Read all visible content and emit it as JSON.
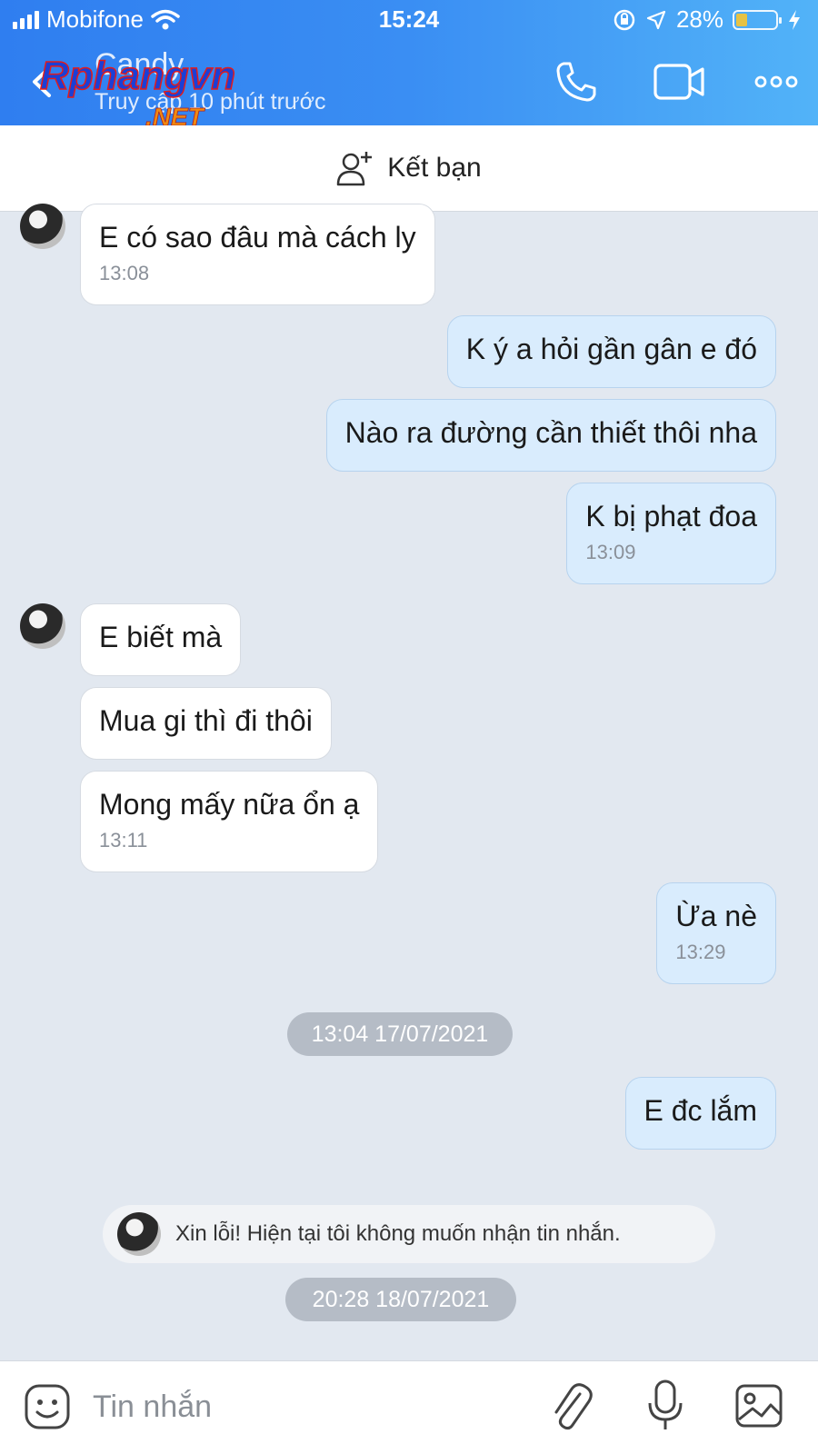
{
  "status_bar": {
    "carrier": "Mobifone",
    "time": "15:24",
    "battery_percent": "28%",
    "battery_level": 0.28
  },
  "header": {
    "contact_name": "Candy",
    "contact_status": "Truy cập 10 phút trước",
    "watermark_text": "Rphangvn",
    "watermark_suffix": ".NET"
  },
  "friend_bar": {
    "label": "Kết bạn"
  },
  "messages": [
    {
      "side": "incoming",
      "text": "E có sao đâu mà cách ly",
      "time": "13:08"
    },
    {
      "side": "outgoing",
      "text": "K ý a hỏi gần gân e đó",
      "time": ""
    },
    {
      "side": "outgoing",
      "text": "Nào ra đường cần thiết thôi nha",
      "time": ""
    },
    {
      "side": "outgoing",
      "text": "K bị phạt đoa",
      "time": "13:09"
    },
    {
      "side": "incoming",
      "text": "E biết mà",
      "time": ""
    },
    {
      "side": "incoming",
      "text": "Mua gi thì đi thôi",
      "time": ""
    },
    {
      "side": "incoming",
      "text": "Mong mấy nữa ổn ạ",
      "time": "13:11"
    },
    {
      "side": "outgoing",
      "text": "Ừa nè",
      "time": "13:29"
    },
    {
      "side": "outgoing",
      "text": "E đc lắm",
      "time": ""
    }
  ],
  "date_separators": [
    "13:04 17/07/2021",
    "20:28 18/07/2021"
  ],
  "system_message": "Xin lỗi! Hiện tại tôi không muốn nhận tin nhắn.",
  "input_bar": {
    "placeholder": "Tin nhắn"
  },
  "colors": {
    "header_start": "#2f7ef0",
    "header_end": "#52b3f8",
    "outgoing_bubble": "#d9ecfd",
    "incoming_bubble": "#ffffff",
    "chat_background": "#e2e8f0"
  }
}
